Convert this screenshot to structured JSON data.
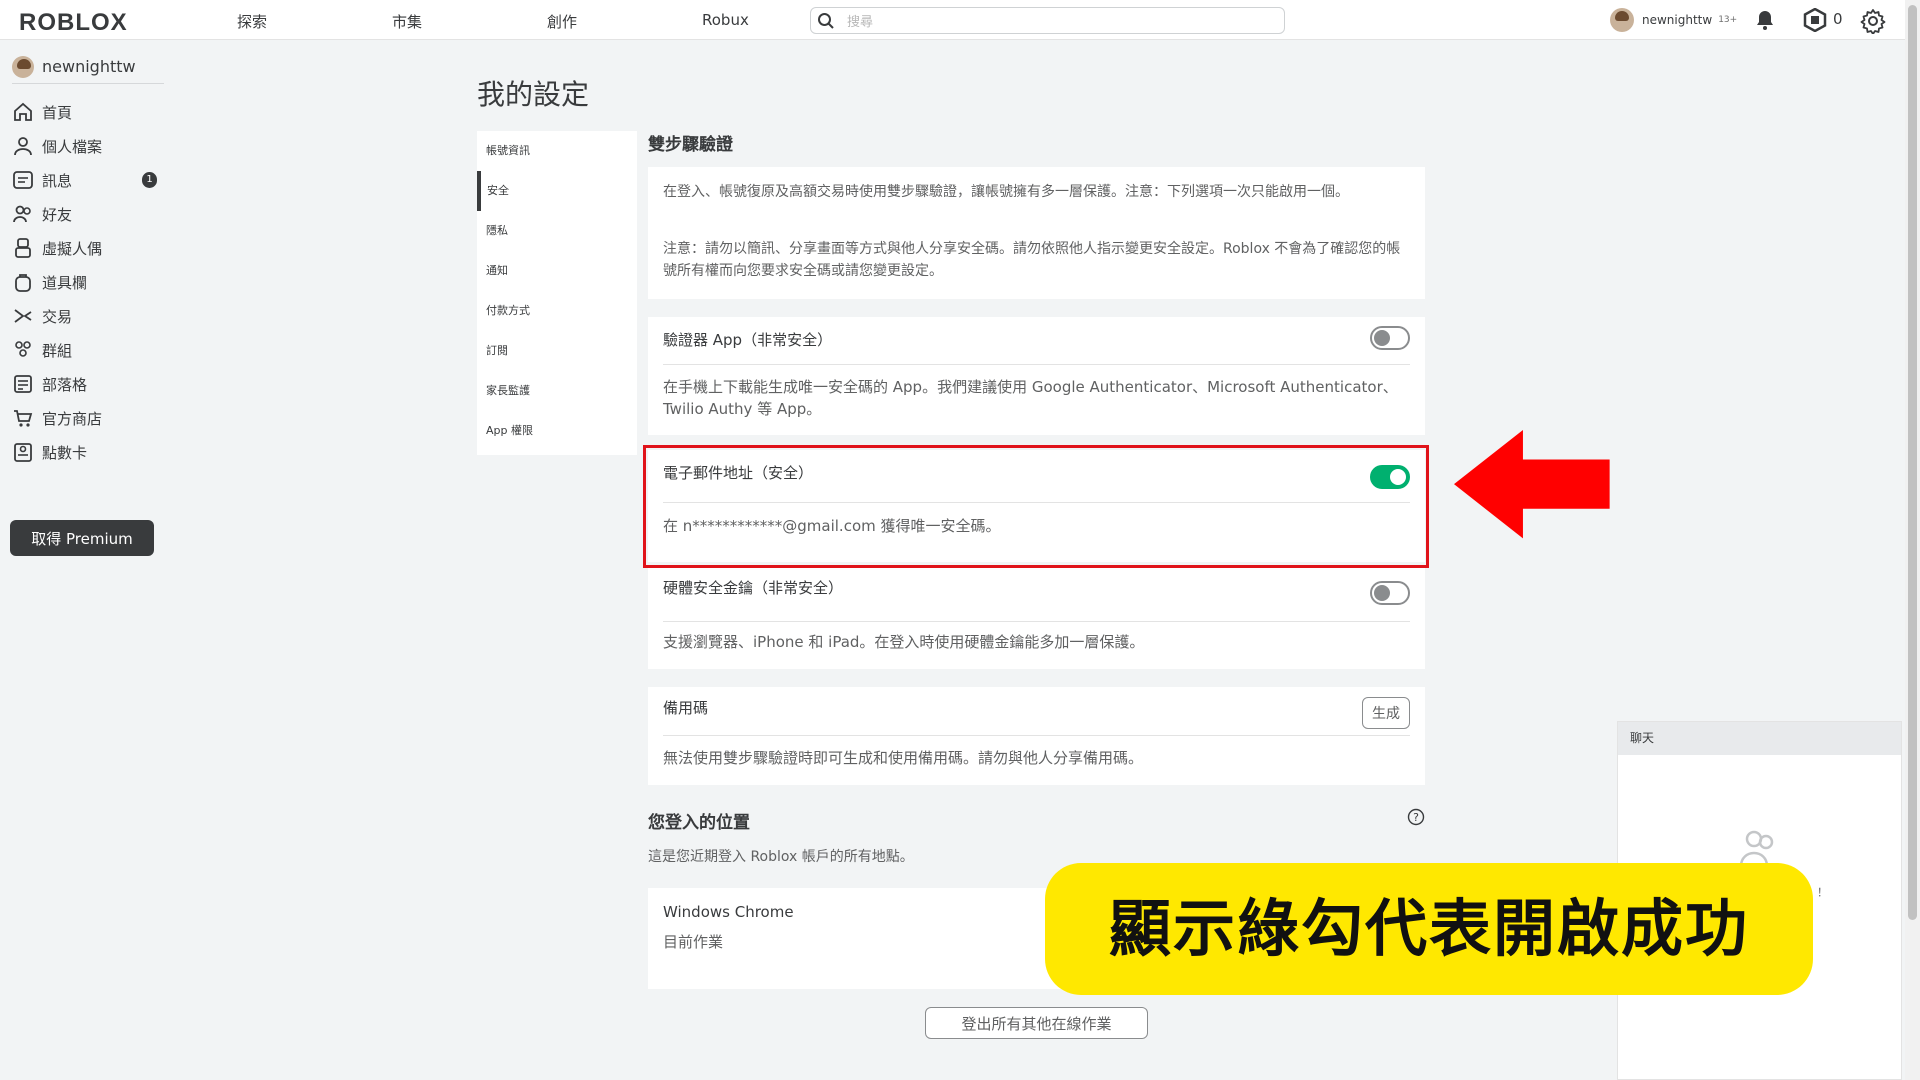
{
  "topbar": {
    "logo": "ROBLOX",
    "nav": [
      "探索",
      "市集",
      "創作",
      "Robux"
    ],
    "search_placeholder": "搜尋",
    "username": "newnighttw",
    "age_badge": "13+",
    "robux": "0"
  },
  "sidebar": {
    "username": "newnighttw",
    "items": [
      {
        "label": "首頁",
        "icon": "home-icon"
      },
      {
        "label": "個人檔案",
        "icon": "profile-icon"
      },
      {
        "label": "訊息",
        "icon": "messages-icon",
        "badge": "1"
      },
      {
        "label": "好友",
        "icon": "friends-icon"
      },
      {
        "label": "虛擬人偶",
        "icon": "avatar-icon"
      },
      {
        "label": "道具欄",
        "icon": "inventory-icon"
      },
      {
        "label": "交易",
        "icon": "trade-icon"
      },
      {
        "label": "群組",
        "icon": "groups-icon"
      },
      {
        "label": "部落格",
        "icon": "blog-icon"
      },
      {
        "label": "官方商店",
        "icon": "store-icon"
      },
      {
        "label": "點數卡",
        "icon": "gift-card-icon"
      }
    ],
    "premium_label": "取得 Premium"
  },
  "page": {
    "title": "我的設定",
    "subnav": [
      "帳號資訊",
      "安全",
      "隱私",
      "通知",
      "付款方式",
      "訂閱",
      "家長監護",
      "App 權限"
    ],
    "active_subnav": "安全"
  },
  "two_step": {
    "title": "雙步驟驗證",
    "notice_1": "在登入、帳號復原及高額交易時使用雙步驟驗證，讓帳號擁有多一層保護。注意：下列選項一次只能啟用一個。",
    "notice_2": "注意：請勿以簡訊、分享畫面等方式與他人分享安全碼。請勿依照他人指示變更安全設定。Roblox 不會為了確認您的帳號所有權而向您要求安全碼或請您變更設定。",
    "authenticator": {
      "title": "驗證器 App（非常安全）",
      "desc": "在手機上下載能生成唯一安全碼的 App。我們建議使用 Google Authenticator、Microsoft Authenticator、Twilio Authy 等 App。",
      "enabled": false
    },
    "email": {
      "title": "電子郵件地址（安全）",
      "desc": "在 n************@gmail.com 獲得唯一安全碼。",
      "enabled": true
    },
    "security_key": {
      "title": "硬體安全金鑰（非常安全）",
      "desc": "支援瀏覽器、iPhone 和 iPad。在登入時使用硬體金鑰能多加一層保護。",
      "enabled": false
    },
    "backup": {
      "title": "備用碼",
      "button": "生成",
      "desc": "無法使用雙步驟驗證時即可生成和使用備用碼。請勿與他人分享備用碼。"
    }
  },
  "sessions": {
    "title": "您登入的位置",
    "desc": "這是您近期登入 Roblox 帳戶的所有地點。",
    "device": "Windows Chrome",
    "status": "目前作業",
    "logout_button": "登出所有其他在線作業"
  },
  "chat": {
    "header": "聊天",
    "partial_text": "！"
  },
  "overlay": {
    "caption": "顯示綠勾代表開啟成功"
  },
  "colors": {
    "toggle_on": "#00b06f",
    "highlight": "#e0131a",
    "caption_bg": "#ffe800"
  }
}
